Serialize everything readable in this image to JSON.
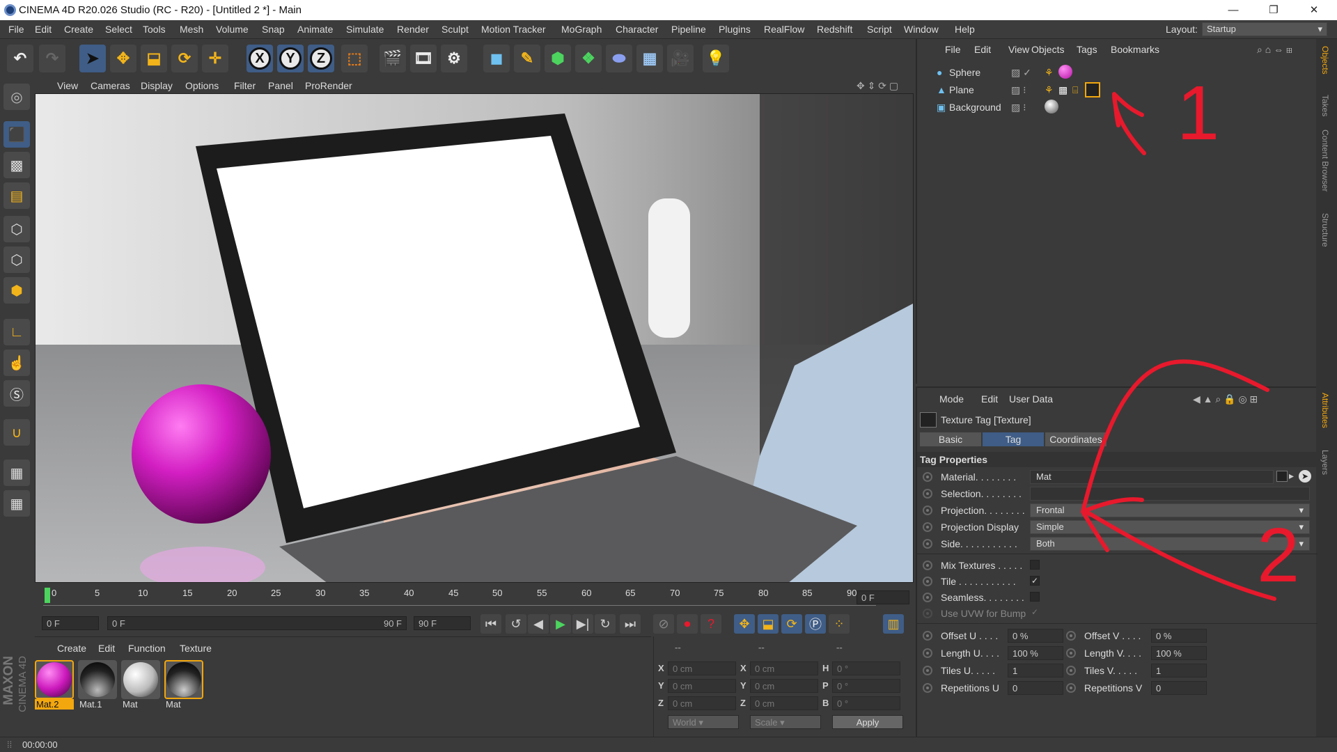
{
  "window": {
    "title": "CINEMA 4D R20.026 Studio (RC - R20) - [Untitled 2 *] - Main",
    "minimize": "—",
    "restore": "❐",
    "close": "✕"
  },
  "menubar": {
    "items": [
      "File",
      "Edit",
      "Create",
      "Select",
      "Tools",
      "Mesh",
      "Volume",
      "Snap",
      "Animate",
      "Simulate",
      "Render",
      "Sculpt",
      "Motion Tracker",
      "MoGraph",
      "Character",
      "Pipeline",
      "Plugins",
      "RealFlow",
      "Redshift",
      "Script",
      "Window",
      "Help"
    ],
    "layout_label": "Layout:",
    "layout_value": "Startup"
  },
  "toolbar": {
    "axis_x": "X",
    "axis_y": "Y",
    "axis_z": "Z"
  },
  "viewport": {
    "menu": [
      "View",
      "Cameras",
      "Display",
      "Options",
      "Filter",
      "Panel",
      "ProRender"
    ]
  },
  "timeline": {
    "ticks": [
      "0",
      "5",
      "10",
      "15",
      "20",
      "25",
      "30",
      "35",
      "40",
      "45",
      "50",
      "55",
      "60",
      "65",
      "70",
      "75",
      "80",
      "85",
      "90"
    ],
    "current_frame": "0 F",
    "start_field": "0 F",
    "range_start": "0 F",
    "range_end": "90 F",
    "end_field": "90 F"
  },
  "materials": {
    "menu": [
      "Create",
      "Edit",
      "Function",
      "Texture"
    ],
    "items": [
      {
        "label": "Mat.2",
        "selected": true
      },
      {
        "label": "Mat.1",
        "selected": false
      },
      {
        "label": "Mat",
        "selected": false
      },
      {
        "label": "Mat",
        "selected": true
      }
    ]
  },
  "coordinates": {
    "header_left": "--",
    "header_mid": "--",
    "header_right": "--",
    "rows": [
      {
        "l1": "X",
        "v1": "0 cm",
        "l2": "X",
        "v2": "0 cm",
        "l3": "H",
        "v3": "0 °"
      },
      {
        "l1": "Y",
        "v1": "0 cm",
        "l2": "Y",
        "v2": "0 cm",
        "l3": "P",
        "v3": "0 °"
      },
      {
        "l1": "Z",
        "v1": "0 cm",
        "l2": "Z",
        "v2": "0 cm",
        "l3": "B",
        "v3": "0 °"
      }
    ],
    "mode_select": "World",
    "scale_select": "Scale",
    "apply_label": "Apply"
  },
  "object_manager": {
    "menu": [
      "File",
      "Edit",
      "View",
      "Objects",
      "Tags",
      "Bookmarks"
    ],
    "objects": [
      "Sphere",
      "Plane",
      "Background"
    ]
  },
  "side_tabs": [
    "Objects",
    "Takes",
    "Content Browser",
    "Structure",
    "Attributes",
    "Layers"
  ],
  "attributes": {
    "menu": [
      "Mode",
      "Edit",
      "User Data"
    ],
    "header": "Texture Tag [Texture]",
    "tabs": [
      "Basic",
      "Tag",
      "Coordinates"
    ],
    "active_tab": "Tag",
    "section": "Tag Properties",
    "material_label": "Material. . . . . . . .",
    "material_value": "Mat",
    "selection_label": "Selection. . . . . . . .",
    "projection_label": "Projection. . . . . . . .",
    "projection_value": "Frontal",
    "projection_display_label": "Projection Display",
    "projection_display_value": "Simple",
    "side_label": "Side. . . . . . . . . . .",
    "side_value": "Both",
    "mix_label": "Mix Textures . . . . .",
    "tile_label": "Tile . . . . . . . . . . .",
    "seamless_label": "Seamless. . . . . . . .",
    "uvw_label": "Use UVW for Bump",
    "offset_u_label": "Offset U . . . .",
    "offset_u": "0 %",
    "offset_v_label": "Offset V . . . .",
    "offset_v": "0 %",
    "length_u_label": "Length U. . . .",
    "length_u": "100 %",
    "length_v_label": "Length V. . . .",
    "length_v": "100 %",
    "tiles_u_label": "Tiles U. . . . .",
    "tiles_u": "1",
    "tiles_v_label": "Tiles V. . . . .",
    "tiles_v": "1",
    "rep_u_label": "Repetitions U",
    "rep_u": "0",
    "rep_v_label": "Repetitions V",
    "rep_v": "0"
  },
  "annotations": {
    "mark_1": "1",
    "mark_2": "2",
    "color": "#e8192c"
  },
  "statusbar": {
    "time": "00:00:00"
  },
  "brand": {
    "maxon": "MAXON",
    "c4d": "CINEMA 4D"
  }
}
